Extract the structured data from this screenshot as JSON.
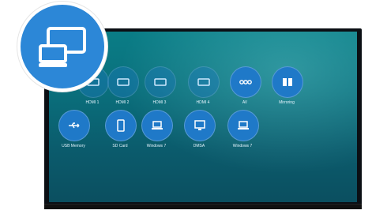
{
  "scene": {
    "brand": "",
    "magnifier_icon": "screen-mirroring-icon"
  },
  "menu": {
    "row1": [
      {
        "label": "HDMI 1",
        "icon": "hdmi-icon"
      },
      {
        "label": "HDMI 2",
        "icon": "hdmi-icon"
      },
      {
        "label": "HDMI 3",
        "icon": "hdmi-icon"
      },
      {
        "label": "HDMI 4",
        "icon": "hdmi-icon"
      },
      {
        "label": "AV",
        "icon": "dots-icon"
      },
      {
        "label": "Mirroring",
        "icon": "book-icon"
      }
    ],
    "row2": [
      {
        "label": "USB Memory",
        "icon": "usb-icon"
      },
      {
        "label": "SD Card",
        "icon": "sd-card-icon"
      },
      {
        "label": "Windows 7",
        "icon": "laptop-icon"
      },
      {
        "label": "DMSA",
        "icon": "monitor-icon"
      },
      {
        "label": "Windows 7",
        "icon": "laptop-icon"
      }
    ]
  },
  "colors": {
    "tile_primary": "#1f79c8",
    "magnifier": "#2c87d7",
    "screen_top": "#0a7d86",
    "screen_bottom": "#0b4f60"
  }
}
